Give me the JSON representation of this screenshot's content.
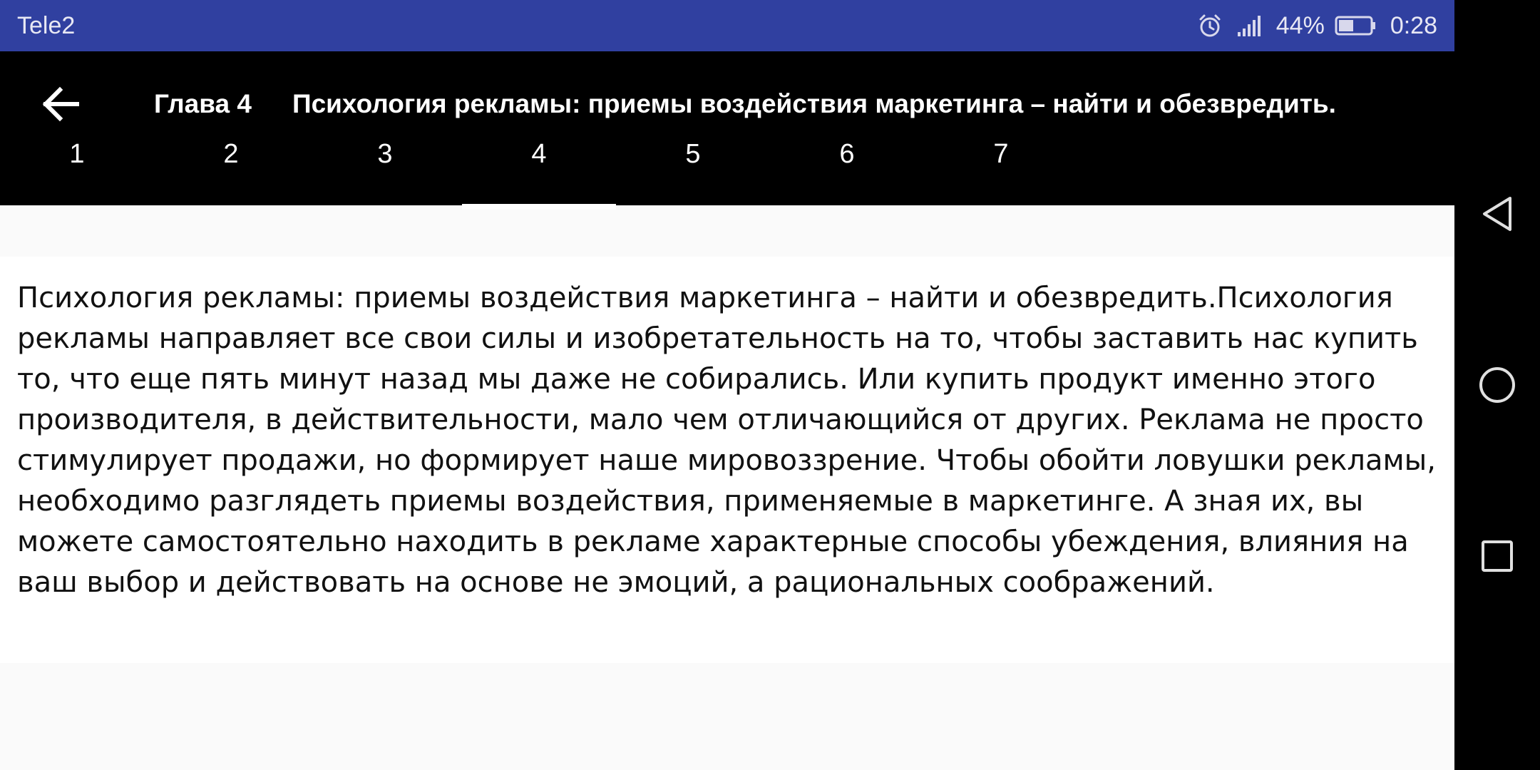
{
  "status_bar": {
    "carrier": "Tele2",
    "battery_pct": "44%",
    "time": "0:28",
    "icons": [
      "alarm-icon",
      "signal-icon",
      "battery-icon"
    ]
  },
  "app_bar": {
    "chapter_label": "Глава 4",
    "chapter_title": "Психология рекламы: приемы воздействия маркетинга – найти и обезвредить.",
    "back_icon": "arrow-left-icon"
  },
  "tabs": {
    "active_index": 3,
    "items": [
      "1",
      "2",
      "3",
      "4",
      "5",
      "6",
      "7"
    ]
  },
  "content": {
    "text": "Психология рекламы: приемы воздействия маркетинга – найти и обезвредить.Психология рекламы направляет все свои силы и изобретательность на то, чтобы заставить нас купить то, что еще пять минут назад мы даже не собирались. Или купить продукт именно этого производителя, в действительности, мало чем отличающийся от других. Реклама не просто стимулирует продажи, но формирует наше мировоззрение. Чтобы обойти ловушки рекламы, необходимо разглядеть приемы воздействия, применяемые в маркетинге. А зная их, вы можете самостоятельно находить в рекламе характерные способы убеждения, влияния на ваш выбор и действовать на основе не эмоций, а рациональных соображений."
  },
  "nav_bar": {
    "icons": [
      "back-triangle-icon",
      "home-circle-icon",
      "recents-square-icon"
    ]
  },
  "colors": {
    "status_bar_bg": "#3040a0",
    "app_bar_bg": "#000000",
    "content_bg": "#ffffff",
    "page_bg": "#fafafa",
    "tab_indicator": "#ffffff"
  }
}
